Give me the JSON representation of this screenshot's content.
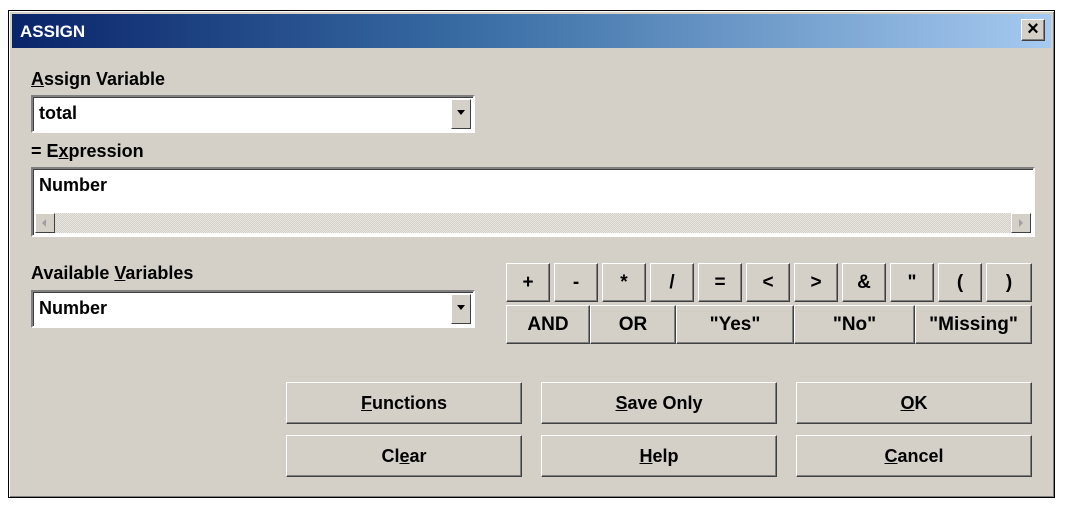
{
  "window": {
    "title": "ASSIGN",
    "close_glyph": "×"
  },
  "assign_variable": {
    "label_pre": "",
    "label_accel": "A",
    "label_post": "ssign Variable",
    "value": "total"
  },
  "expression": {
    "label_pre": "= E",
    "label_accel": "x",
    "label_post": "pression",
    "value": "Number"
  },
  "available_variables": {
    "label_pre": "Available ",
    "label_accel": "V",
    "label_post": "ariables",
    "value": "Number"
  },
  "operators_row1": [
    "+",
    "-",
    "*",
    "/",
    "=",
    "<",
    ">",
    "&",
    "\"",
    "(",
    ")"
  ],
  "operators_row2": [
    "AND",
    "OR",
    "\"Yes\"",
    "\"No\"",
    "\"Missing\""
  ],
  "buttons": {
    "functions": {
      "pre": "",
      "accel": "F",
      "post": "unctions"
    },
    "save_only": {
      "pre": "",
      "accel": "S",
      "post": "ave Only"
    },
    "ok": {
      "pre": "",
      "accel": "O",
      "post": "K"
    },
    "clear": {
      "pre": "Cl",
      "accel": "e",
      "post": "ar"
    },
    "help": {
      "pre": "",
      "accel": "H",
      "post": "elp"
    },
    "cancel": {
      "pre": "",
      "accel": "C",
      "post": "ancel"
    }
  },
  "colors": {
    "face": "#d4d0c8",
    "title_start": "#0a246a",
    "title_end": "#a6caf0"
  },
  "icons": [
    "close-icon",
    "dropdown-arrow-icon",
    "scroll-left-arrow-icon",
    "scroll-right-arrow-icon"
  ]
}
